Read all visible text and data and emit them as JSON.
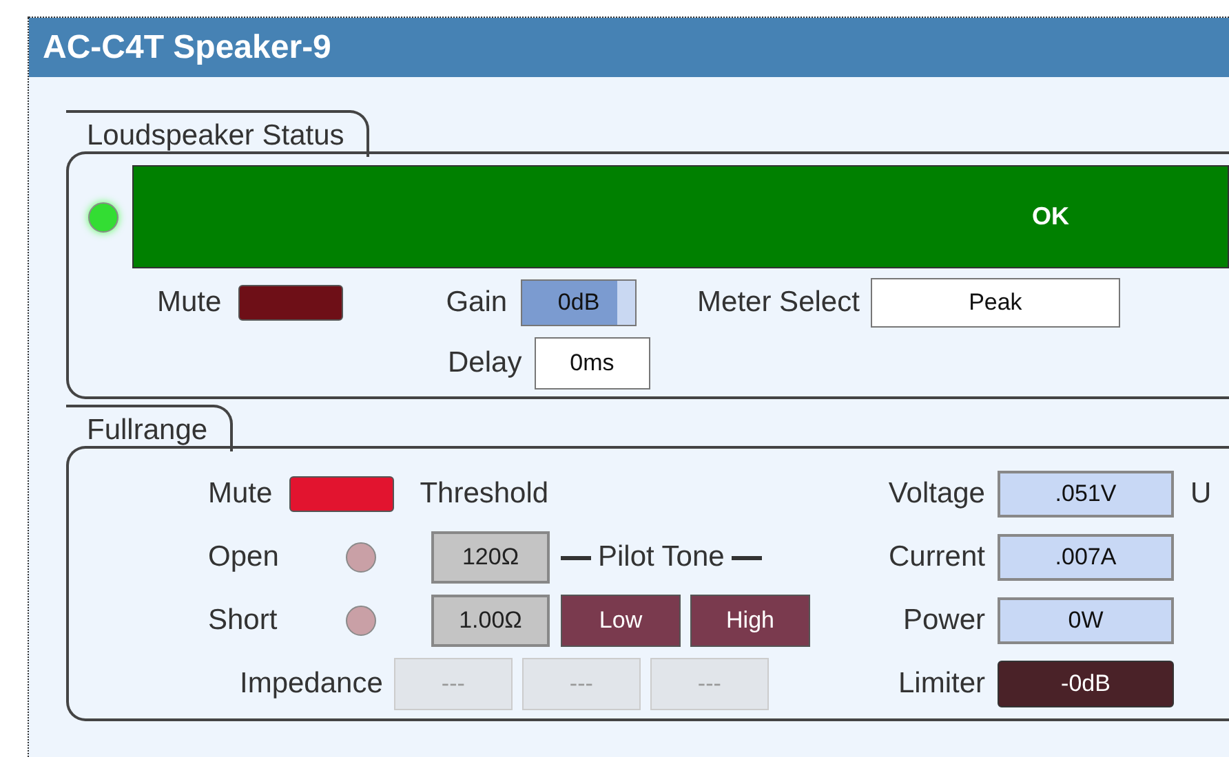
{
  "window": {
    "title": "AC-C4T Speaker-9"
  },
  "loudspeaker_status": {
    "title": "Loudspeaker Status",
    "status_led": {
      "on": true
    },
    "status_bar": {
      "text": "OK"
    },
    "mute": {
      "label": "Mute",
      "on": false
    },
    "gain": {
      "label": "Gain",
      "value": "0dB"
    },
    "meter_select": {
      "label": "Meter Select",
      "value": "Peak"
    },
    "delay": {
      "label": "Delay",
      "value": "0ms"
    }
  },
  "fullrange": {
    "title": "Fullrange",
    "mute": {
      "label": "Mute",
      "on": true
    },
    "threshold_label": "Threshold",
    "open": {
      "label": "Open",
      "on": false,
      "value": "120Ω"
    },
    "short": {
      "label": "Short",
      "on": false,
      "value": "1.00Ω"
    },
    "pilot_tone": {
      "label": "Pilot Tone",
      "buttons": [
        {
          "label": "Low"
        },
        {
          "label": "High"
        }
      ]
    },
    "impedance": {
      "label": "Impedance",
      "values": [
        "---",
        "---",
        "---"
      ]
    },
    "readings": [
      {
        "label": "Voltage",
        "value": ".051V",
        "kind": "meter"
      },
      {
        "label": "Current",
        "value": ".007A",
        "kind": "meter"
      },
      {
        "label": "Power",
        "value": "0W",
        "kind": "meter"
      },
      {
        "label": "Limiter",
        "value": "-0dB",
        "kind": "limiter"
      }
    ],
    "column_3_label": "U"
  }
}
